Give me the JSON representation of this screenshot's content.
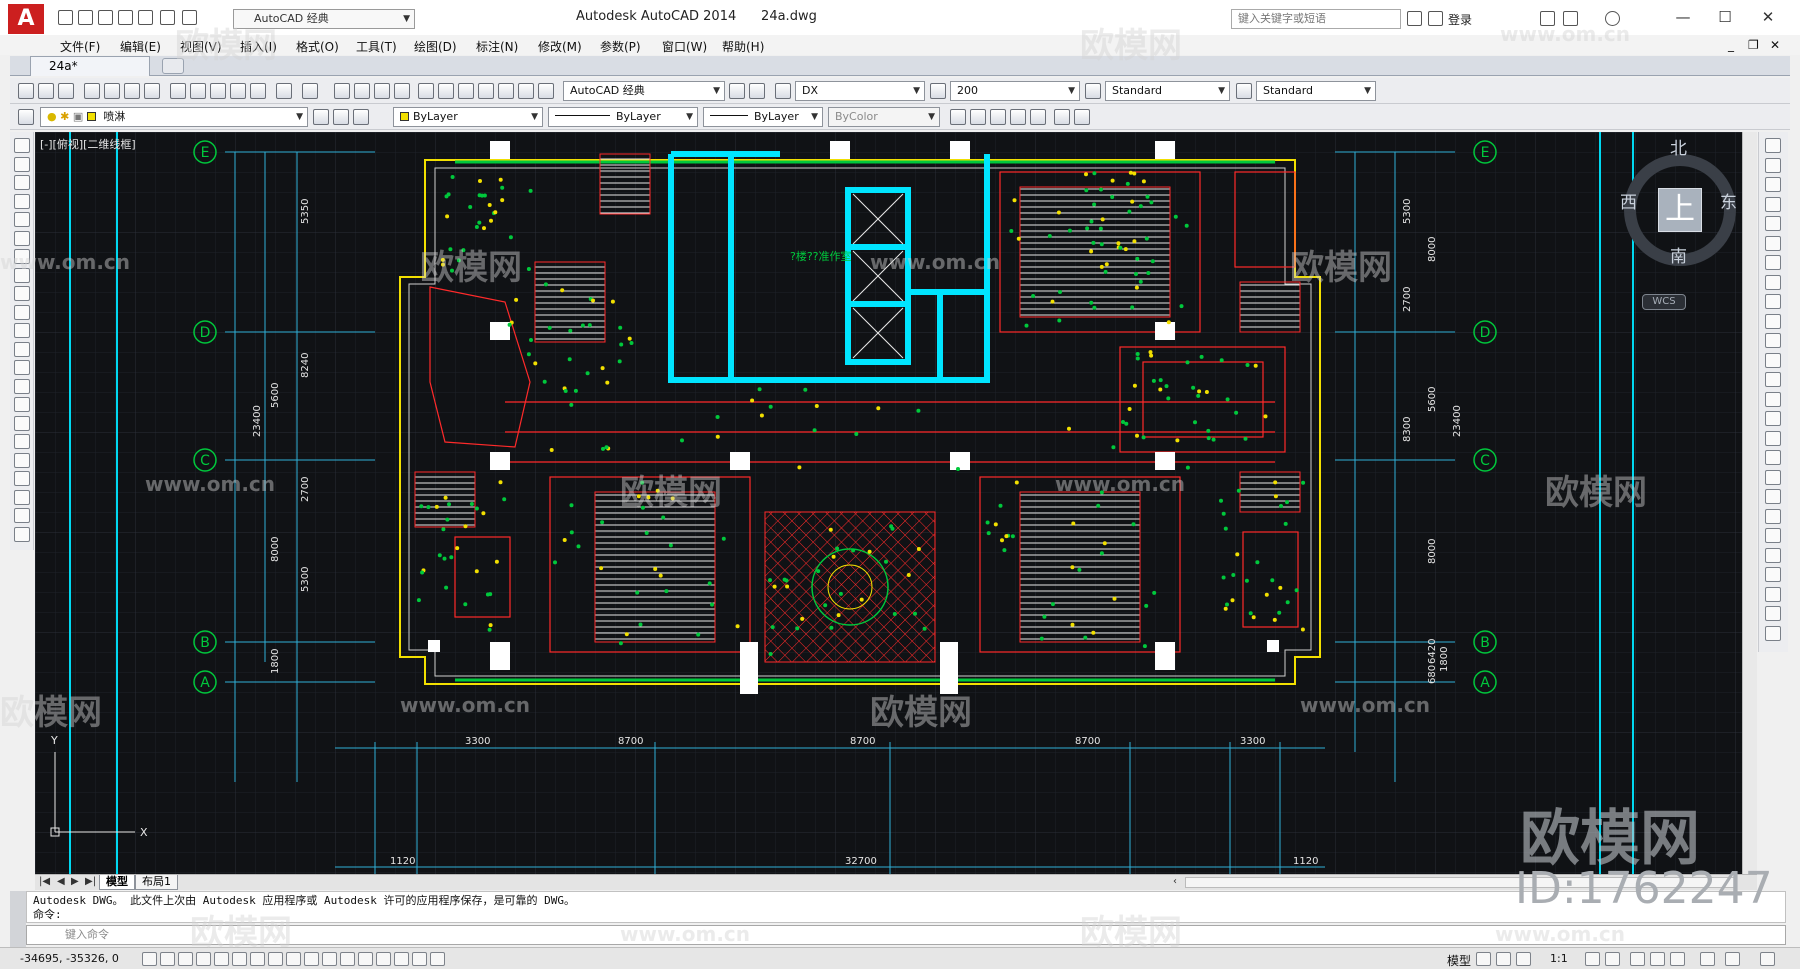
{
  "titlebar": {
    "workspace_label": "AutoCAD 经典",
    "app_title": "Autodesk AutoCAD 2014",
    "file_name": "24a.dwg",
    "search_placeholder": "键入关键字或短语",
    "login_label": "登录"
  },
  "menubar": {
    "items": [
      "文件(F)",
      "编辑(E)",
      "视图(V)",
      "插入(I)",
      "格式(O)",
      "工具(T)",
      "绘图(D)",
      "标注(N)",
      "修改(M)",
      "参数(P)",
      "窗口(W)",
      "帮助(H)"
    ]
  },
  "tabs": {
    "file_tab": "24a*"
  },
  "toolbar1": {
    "workspace": "AutoCAD 经典",
    "text_style": "DX",
    "dim_scale": "200",
    "dim_style": "Standard",
    "table_style": "Standard"
  },
  "toolbar2": {
    "layer": "喷淋",
    "color": "ByLayer",
    "linetype": "ByLayer",
    "lineweight": "ByLayer",
    "plotstyle": "ByColor"
  },
  "viewport": {
    "label": "[-][俯视][二维线框]"
  },
  "drawing": {
    "grid_labels_left": [
      "E",
      "D",
      "C",
      "B",
      "A"
    ],
    "grid_labels_right": [
      "E",
      "D",
      "C",
      "B",
      "A"
    ],
    "dims_bottom": [
      "1120",
      "3300",
      "8700",
      "8700",
      "8700",
      "3300",
      "1120"
    ],
    "dim_total_bottom": "32700",
    "dims_left": [
      "5350",
      "8240",
      "5600",
      "2700",
      "8000",
      "5300",
      "1800",
      "23400"
    ],
    "dims_right": [
      "5300",
      "8000",
      "2700",
      "5600",
      "8300",
      "23400",
      "8000",
      "6420",
      "1800",
      "680"
    ],
    "center_label": "?楼??准作室",
    "accent_cyan": "#00e5ff",
    "accent_green": "#00c83c",
    "accent_red": "#ff2a2a",
    "accent_yellow": "#f2e000",
    "background": "#101215"
  },
  "viewcube": {
    "north": "北",
    "south": "南",
    "east": "东",
    "west": "西",
    "top": "上",
    "wcs": "WCS"
  },
  "layout_tabs": [
    "模型",
    "布局1"
  ],
  "command": {
    "history_line1": "Autodesk DWG。  此文件上次由 Autodesk 应用程序或 Autodesk 许可的应用程序保存，是可靠的 DWG。",
    "history_line2": "命令:",
    "input_placeholder": "键入命令"
  },
  "statusbar": {
    "coords": "-34695, -35326, 0",
    "model_label": "模型",
    "scale": "1:1"
  },
  "watermark": {
    "brand": "欧模网",
    "url": "www.om.cn",
    "id": "ID:1762247"
  }
}
